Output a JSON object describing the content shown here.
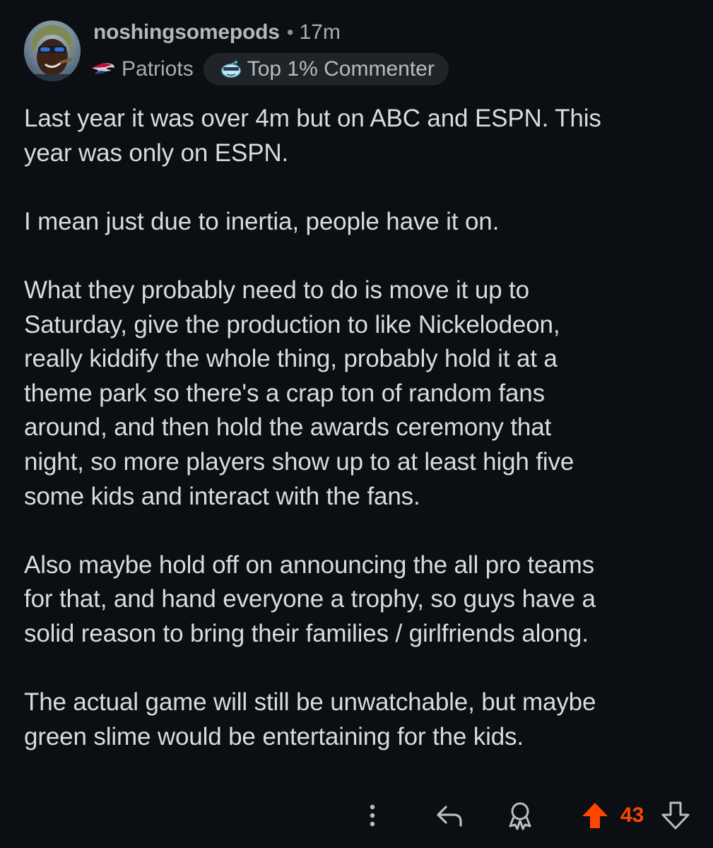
{
  "comment": {
    "author": "noshingsomepods",
    "separator": "•",
    "time_ago": "17m",
    "flair": {
      "team": "Patriots",
      "team_icon": "patriots-logo-icon"
    },
    "badge": {
      "label": "Top 1% Commenter",
      "icon": "sunglasses-snoo-icon"
    },
    "paragraphs": [
      "Last year it was over 4m but on ABC and ESPN. This\nyear was only on ESPN.",
      "I mean just due to inertia, people have it on.",
      "What they probably need to do is move it up to\nSaturday, give the production to like Nickelodeon,\nreally kiddify the whole thing, probably hold it at a\ntheme park so there's a crap ton of random fans\naround, and then hold the awards ceremony that\nnight, so more players show up to at least high five\nsome kids and interact with the fans.",
      "Also maybe hold off on announcing the all pro teams\nfor that, and hand everyone a trophy, so guys have a\nsolid reason to bring their families / girlfriends along.",
      "The actual game will still be unwatchable, but maybe\ngreen slime would be entertaining for the kids."
    ],
    "actions": {
      "more_icon": "more-vertical-icon",
      "reply_icon": "reply-icon",
      "award_icon": "award-icon",
      "upvote_icon": "upvote-icon",
      "downvote_icon": "downvote-icon",
      "vote_count": "43"
    },
    "colors": {
      "background": "#0b0e12",
      "upvoted": "#ff4500",
      "text": "#d9dcde",
      "muted": "#a8adb2"
    }
  }
}
